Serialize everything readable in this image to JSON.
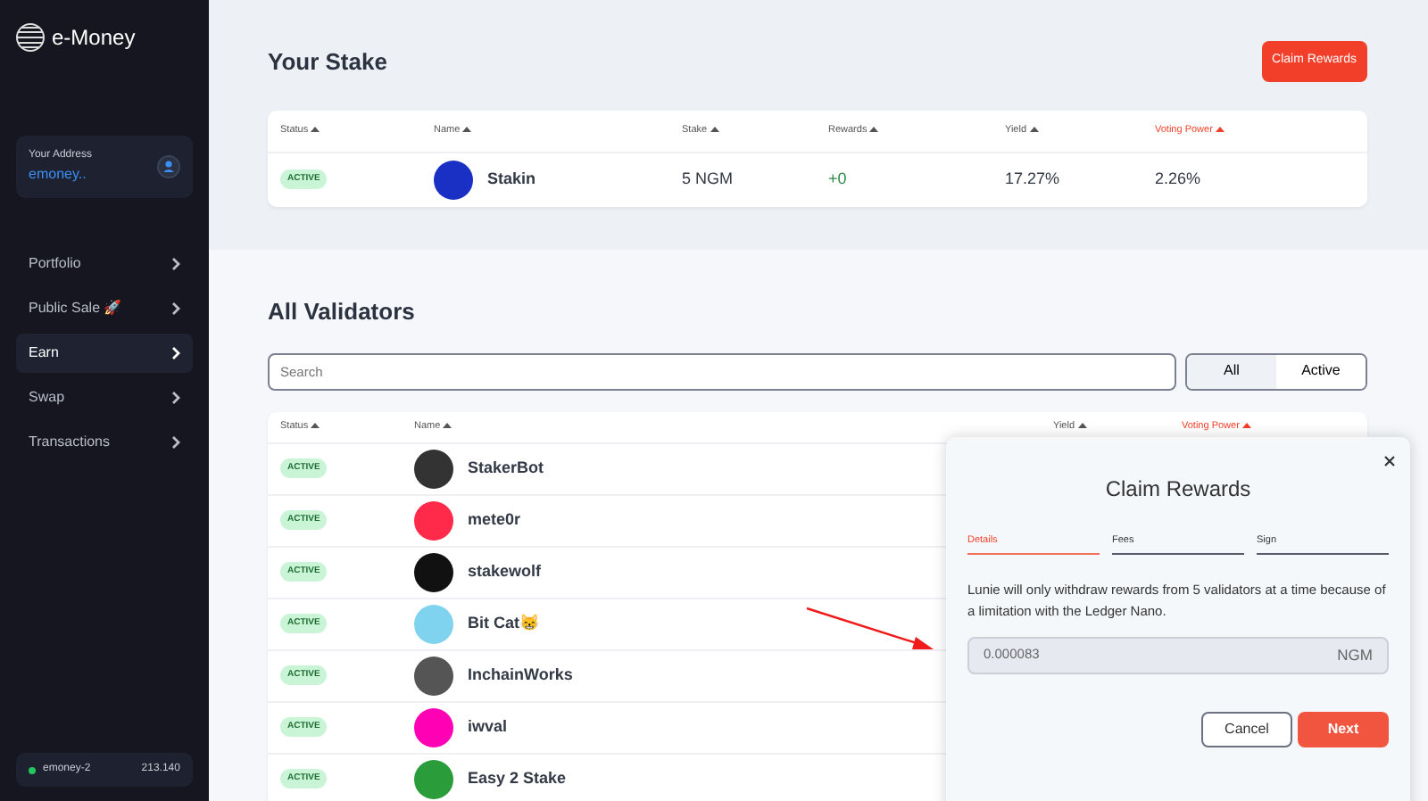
{
  "sidebar": {
    "logo": "e-Money",
    "address": {
      "label": "Your Address",
      "value": "emoney.."
    },
    "items": [
      {
        "label": "Portfolio",
        "selected": false
      },
      {
        "label": "Public Sale 🚀",
        "selected": false
      },
      {
        "label": "Earn",
        "selected": true
      },
      {
        "label": "Swap",
        "selected": false
      },
      {
        "label": "Transactions",
        "selected": false
      }
    ],
    "network": {
      "name": "emoney-2",
      "block": "213.140",
      "online": true
    }
  },
  "your_stake": {
    "title": "Your Stake",
    "claim_button": "Claim Rewards",
    "columns": [
      {
        "label": "Status",
        "selected": false
      },
      {
        "label": "Name",
        "selected": false
      },
      {
        "label": "Stake",
        "selected": false
      },
      {
        "label": "Rewards",
        "selected": false
      },
      {
        "label": "Yield",
        "selected": false
      },
      {
        "label": "Voting Power",
        "selected": true
      }
    ],
    "rows": [
      {
        "status": "ACTIVE",
        "name": "Stakin",
        "color": "#1a2fc4",
        "stake": "5 NGM",
        "rewards": "+0",
        "yield": "17.27%",
        "voting_power": "2.26%"
      }
    ]
  },
  "all_validators": {
    "title": "All Validators",
    "search": {
      "placeholder": "Search"
    },
    "filters": [
      {
        "label": "All",
        "selected": true
      },
      {
        "label": "Active",
        "selected": false
      }
    ],
    "columns": [
      {
        "label": "Status",
        "selected": false
      },
      {
        "label": "Name",
        "selected": false
      },
      {
        "label": "Yield",
        "selected": false
      },
      {
        "label": "Voting Power",
        "selected": true
      }
    ],
    "rows": [
      {
        "status": "ACTIVE",
        "name": "StakerBot",
        "color": "#333333"
      },
      {
        "status": "ACTIVE",
        "name": "mete0r",
        "color": "#ff2a4a"
      },
      {
        "status": "ACTIVE",
        "name": "stakewolf",
        "color": "#111111"
      },
      {
        "status": "ACTIVE",
        "name": "Bit Cat😸",
        "color": "#7fd3ef"
      },
      {
        "status": "ACTIVE",
        "name": "InchainWorks",
        "color": "#555555"
      },
      {
        "status": "ACTIVE",
        "name": "iwval",
        "color": "#ff00b4"
      },
      {
        "status": "ACTIVE",
        "name": "Easy 2 Stake",
        "color": "#2a9d3a"
      }
    ]
  },
  "modal": {
    "title": "Claim Rewards",
    "steps": [
      {
        "label": "Details",
        "selected": true
      },
      {
        "label": "Fees",
        "selected": false
      },
      {
        "label": "Sign",
        "selected": false
      }
    ],
    "message": "Lunie will only withdraw rewards from 5 validators at a time because of a limitation with the Ledger Nano.",
    "amount": {
      "value": "0.000083",
      "unit": "NGM"
    },
    "buttons": [
      {
        "label": "Cancel",
        "kind": "secondary"
      },
      {
        "label": "Next",
        "kind": "primary"
      }
    ]
  }
}
